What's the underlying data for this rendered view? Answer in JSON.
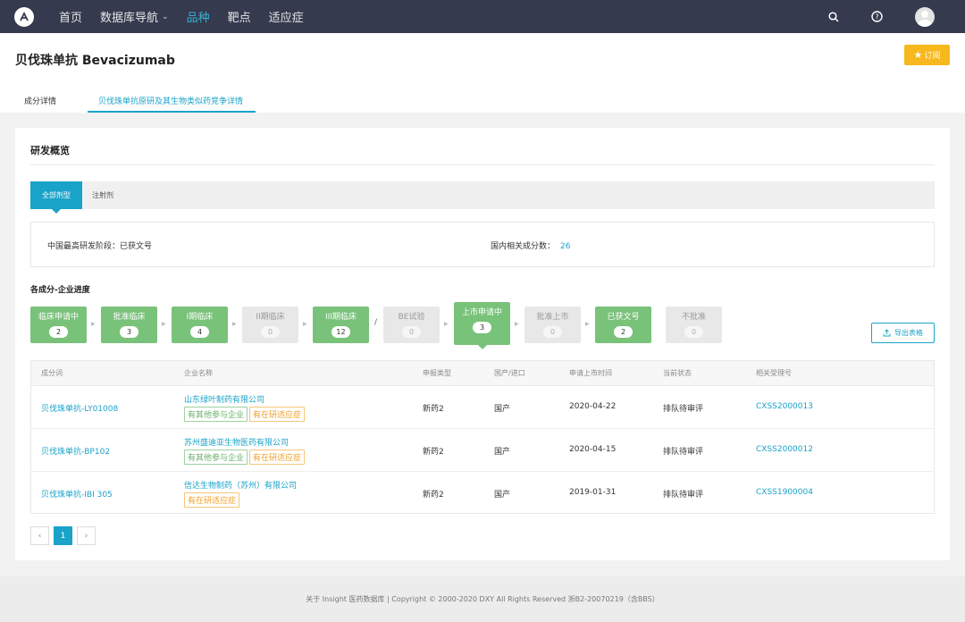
{
  "nav": {
    "items": [
      {
        "label": "首页",
        "active": false
      },
      {
        "label": "数据库导航",
        "active": false,
        "has_dropdown": true
      },
      {
        "label": "品种",
        "active": true
      },
      {
        "label": "靶点",
        "active": false
      },
      {
        "label": "适应症",
        "active": false
      }
    ],
    "icons": [
      "search-icon",
      "help-icon",
      "avatar"
    ]
  },
  "header": {
    "title": "贝伐珠单抗 Bevacizumab",
    "subscribe_label": "订阅",
    "tabs": [
      {
        "label": "成分详情",
        "active": false
      },
      {
        "label": "贝伐珠单抗原研及其生物类似药竞争详情",
        "active": true
      }
    ]
  },
  "overview": {
    "title": "研发概览",
    "form_tabs": [
      {
        "label": "全部剂型",
        "active": true
      },
      {
        "label": "注射剂",
        "active": false
      }
    ],
    "highest_stage_label": "中国最高研发阶段：已获文号",
    "related_count_label": "国内相关成分数：",
    "related_count": "26"
  },
  "progress": {
    "title": "各成分-企业进度",
    "stages": [
      {
        "label": "临床申请中",
        "count": "2",
        "active": true
      },
      {
        "label": "批准临床",
        "count": "3",
        "active": true
      },
      {
        "label": "I期临床",
        "count": "4",
        "active": true
      },
      {
        "label": "II期临床",
        "count": "0",
        "active": false
      },
      {
        "label": "III期临床",
        "count": "12",
        "active": true
      },
      {
        "label": "BE试验",
        "count": "0",
        "active": false
      },
      {
        "label": "上市申请中",
        "count": "3",
        "active": true,
        "selected": true
      },
      {
        "label": "批准上市",
        "count": "0",
        "active": false
      },
      {
        "label": "已获文号",
        "count": "2",
        "active": true
      },
      {
        "label": "不批准",
        "count": "0",
        "active": false
      }
    ],
    "export_label": "导出表格"
  },
  "table": {
    "headers": [
      "成分词",
      "企业名称",
      "申报类型",
      "国产/进口",
      "申请上市时间",
      "当前状态",
      "相关受理号"
    ],
    "rows": [
      {
        "ingredient": "贝伐珠单抗-LY01008",
        "company": "山东绿叶制药有限公司",
        "tags": [
          "有其他参与企业",
          "有在研适应症"
        ],
        "type": "新药2",
        "origin": "国产",
        "date": "2020-04-22",
        "status": "排队待审评",
        "acceptance_no": "CXSS2000013"
      },
      {
        "ingredient": "贝伐珠单抗-BP102",
        "company": "苏州盛迪亚生物医药有限公司",
        "tags": [
          "有其他参与企业",
          "有在研适应症"
        ],
        "type": "新药2",
        "origin": "国产",
        "date": "2020-04-15",
        "status": "排队待审评",
        "acceptance_no": "CXSS2000012"
      },
      {
        "ingredient": "贝伐珠单抗-IBI 305",
        "company": "信达生物制药（苏州）有限公司",
        "tags": [
          "有在研适应症"
        ],
        "type": "新药2",
        "origin": "国产",
        "date": "2019-01-31",
        "status": "排队待审评",
        "acceptance_no": "CXSS1900004"
      }
    ]
  },
  "pagination": {
    "prev": "‹",
    "current": "1",
    "next": "›"
  },
  "footer": {
    "text": "关于 Insight 医药数据库 | Copyright © 2000-2020 DXY All Rights Reserved 浙B2-20070219（含BBS）"
  },
  "colors": {
    "accent": "#1aa3c9",
    "nav_bg": "#353a4e",
    "stage_active": "#79c27a",
    "subscribe": "#f6b81c"
  }
}
